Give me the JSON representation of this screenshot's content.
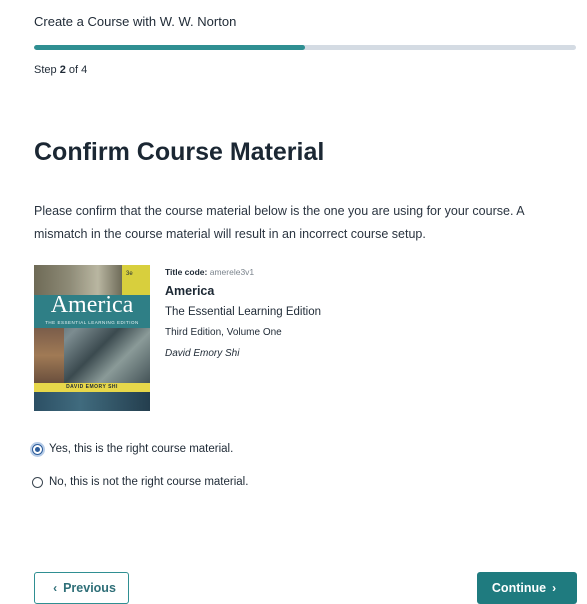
{
  "header": {
    "title": "Create a Course with W. W. Norton"
  },
  "progress": {
    "current_step": 2,
    "total_steps": 4,
    "fill_fraction": 0.5
  },
  "step": {
    "prefix": "Step ",
    "current": "2",
    "suffix": " of 4"
  },
  "page": {
    "title": "Confirm Course Material",
    "instructions": "Please confirm that the course material below is the one you are using for your course. A mismatch in the course material will result in an incorrect course setup."
  },
  "book": {
    "code_label": "Title code:",
    "code_value": "amerele3v1",
    "title": "America",
    "subtitle": "The Essential Learning Edition",
    "edition": "Third Edition, Volume One",
    "author": "David Emory Shi",
    "cover": {
      "title": "America",
      "subtitle": "THE ESSENTIAL LEARNING EDITION",
      "author": "DAVID EMORY SHI",
      "edition": "3e"
    }
  },
  "options": [
    {
      "label": "Yes, this is the right course material.",
      "selected": true
    },
    {
      "label": "No, this is not the right course material.",
      "selected": false
    }
  ],
  "buttons": {
    "previous": "Previous",
    "continue": "Continue"
  },
  "colors": {
    "accent": "#2f8f92",
    "primary_button": "#1f7b7f",
    "track": "#d4dbe3",
    "radio_selected": "#2c5c9a"
  }
}
